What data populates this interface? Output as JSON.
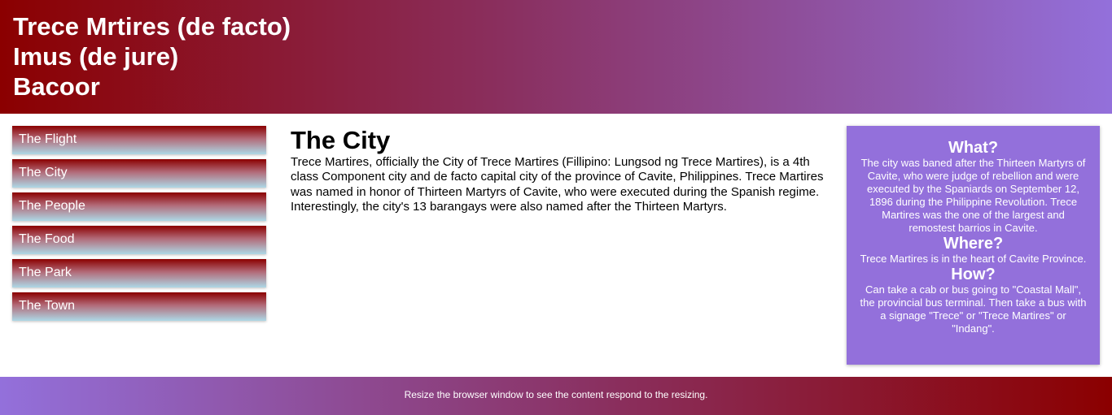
{
  "header": {
    "lines": [
      "Trece Mrtires (de facto)",
      "Imus (de jure)",
      "Bacoor"
    ]
  },
  "menu": {
    "items": [
      {
        "label": "The Flight"
      },
      {
        "label": "The City"
      },
      {
        "label": "The People"
      },
      {
        "label": "The Food"
      },
      {
        "label": "The Park"
      },
      {
        "label": "The Town"
      }
    ]
  },
  "main": {
    "title": "The City",
    "body": "Trece Martires, officially the City of Trece Martires (Fillipino: Lungsod ng Trece Martires), is a 4th class Component city and de facto capital city of the province of Cavite, Philippines. Trece Martires was named in honor of Thirteen Martyrs of Cavite, who were executed during the Spanish regime. Interestingly, the city's 13 barangays were also named after the Thirteen Martyrs."
  },
  "aside": {
    "what_heading": "What?",
    "what_text": "The city was baned after the Thirteen Martyrs of Cavite, who were judge of rebellion and were executed by the Spaniards on September 12, 1896 during the Philippine Revolution. Trece Martires was the one of the largest and remostest barrios in Cavite.",
    "where_heading": "Where?",
    "where_text": "Trece Martires is in the heart of Cavite Province.",
    "how_heading": "How?",
    "how_text": "Can take a cab or bus going to \"Coastal Mall\", the provincial bus terminal. Then take a bus with a signage \"Trece\" or \"Trece Martires\" or \"Indang\"."
  },
  "footer": {
    "text": "Resize the browser window to see the content respond to the resizing."
  },
  "colors": {
    "header_gradient_start": "#8b0000",
    "header_gradient_end": "#9370db",
    "aside_bg": "#9370db",
    "menu_gradient_top": "#8b0000",
    "menu_gradient_bottom": "#add8e6"
  }
}
